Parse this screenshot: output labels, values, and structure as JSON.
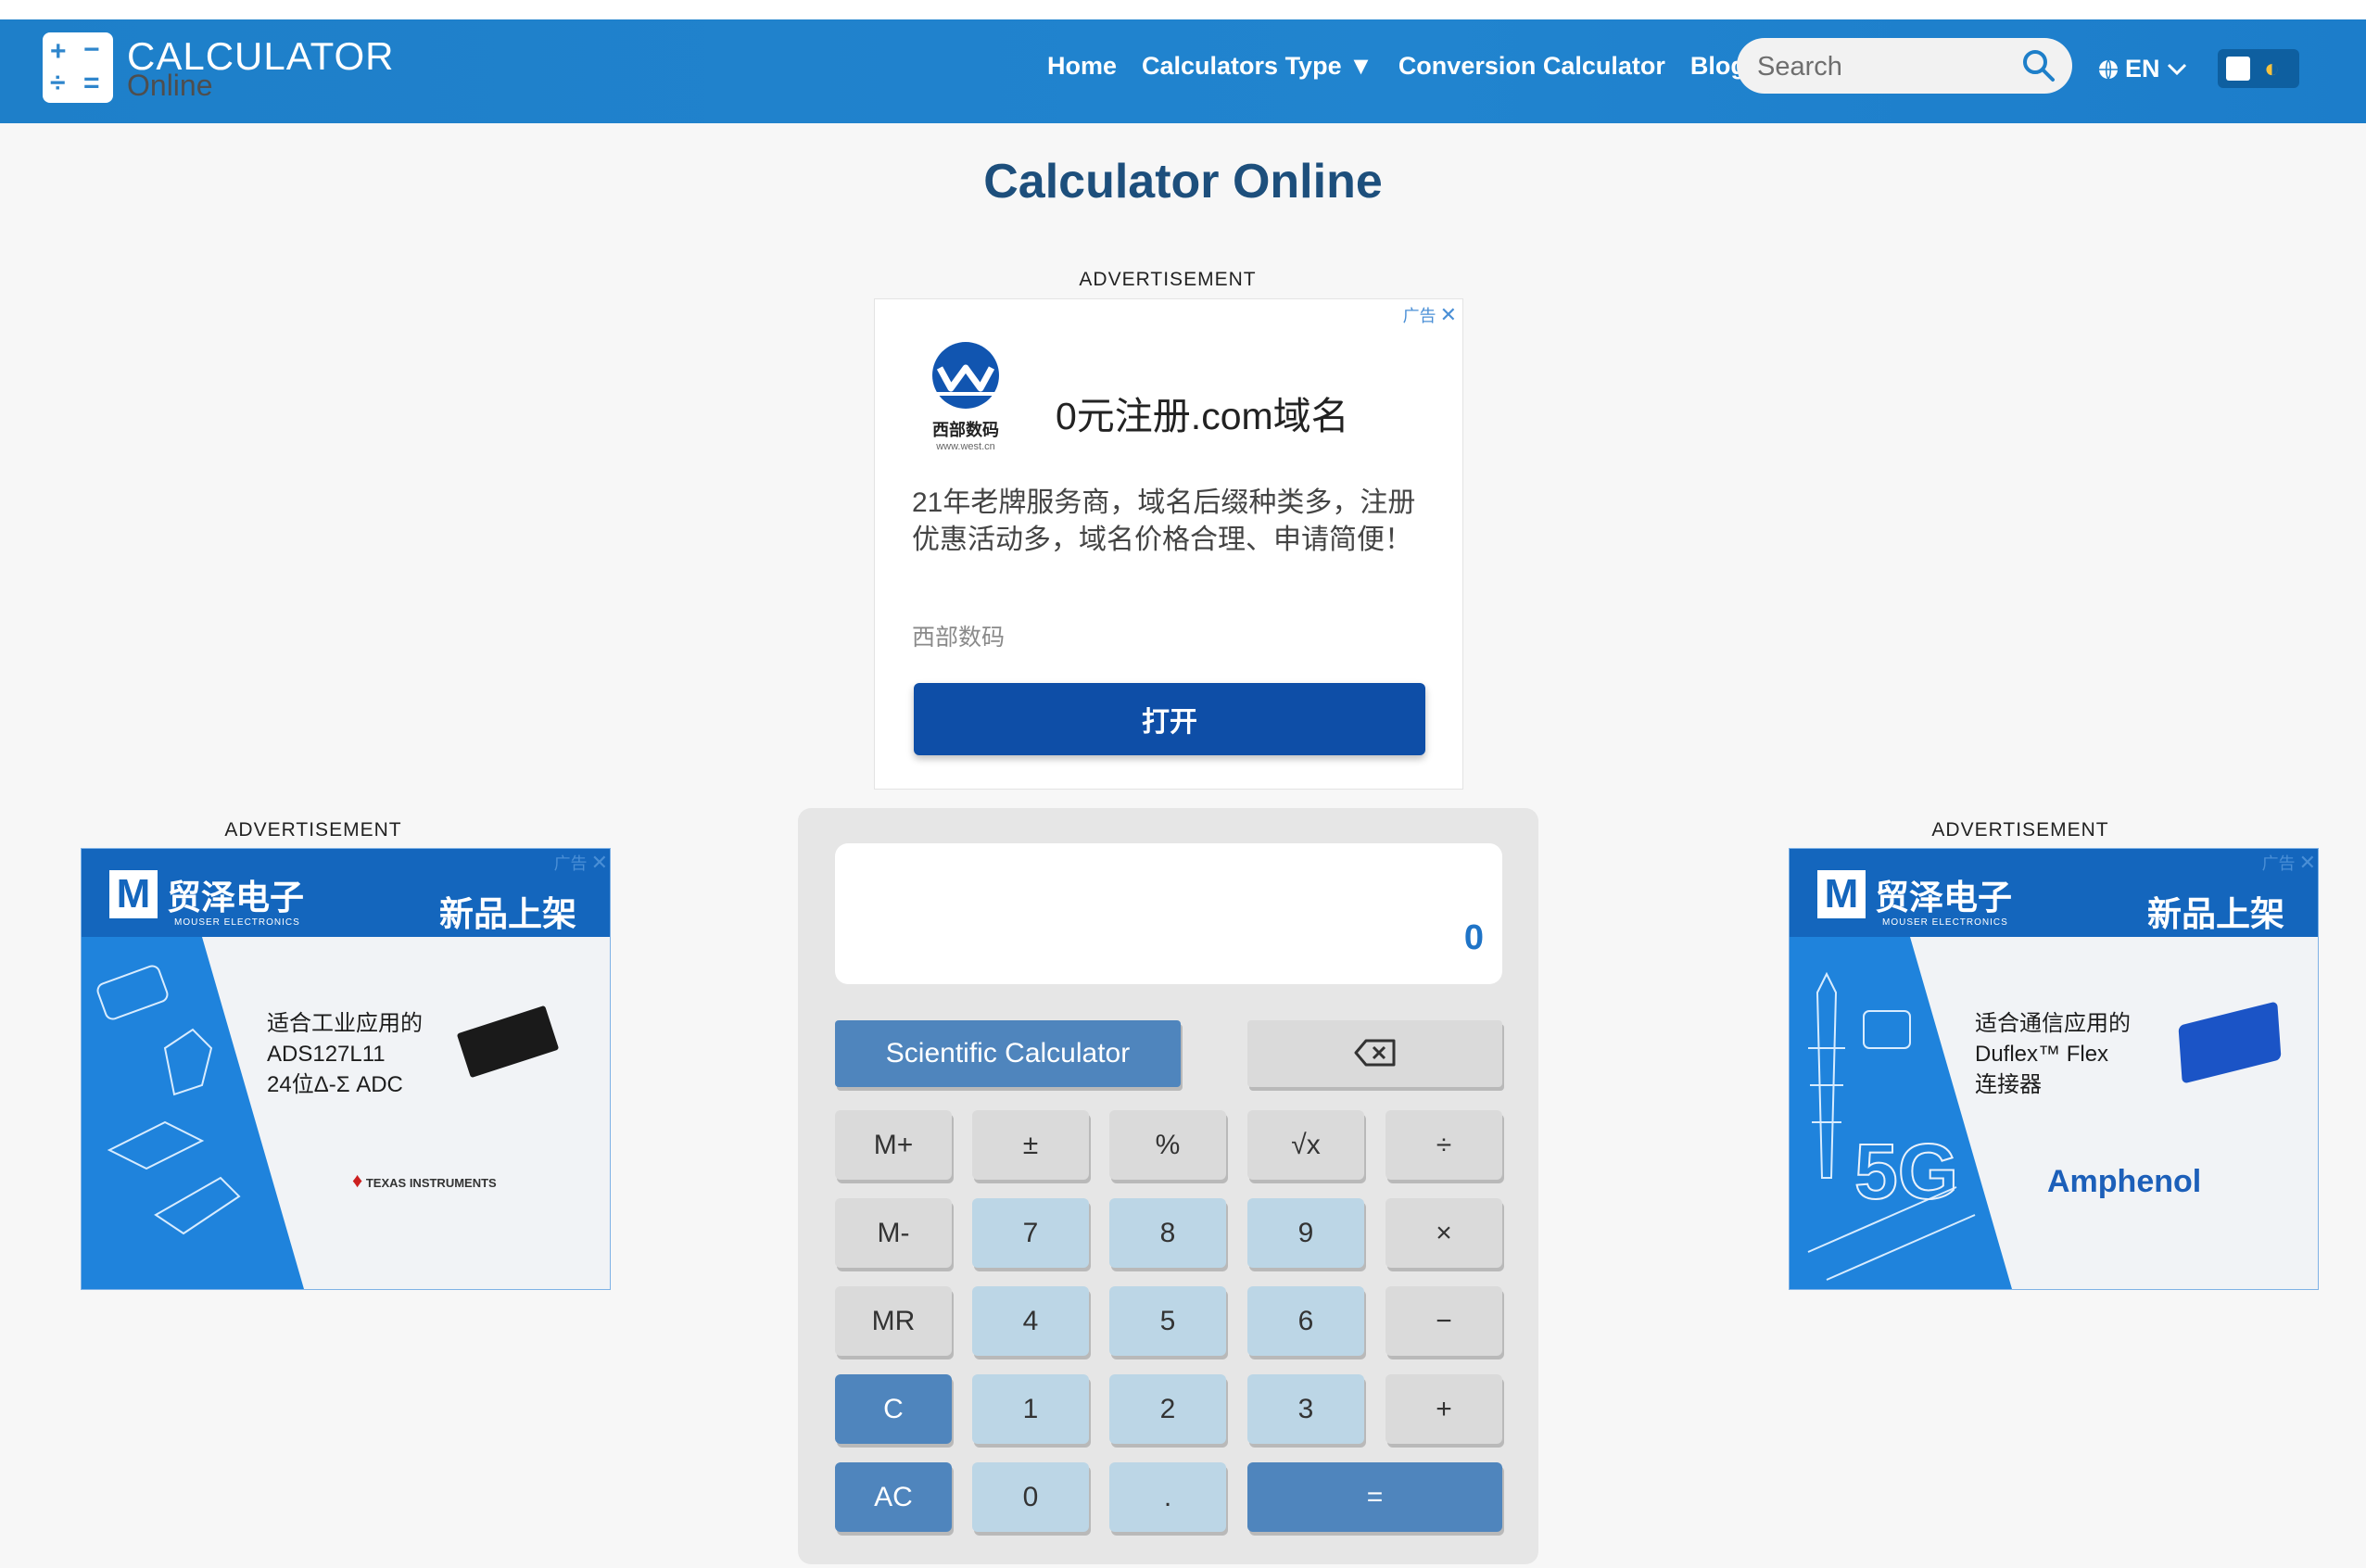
{
  "header": {
    "logo_title": "CALCULATOR",
    "logo_subtitle": "Online",
    "nav": {
      "home": "Home",
      "calculators_type": "Calculators Type ▼",
      "conversion": "Conversion Calculator",
      "blog": "Blog"
    },
    "search_placeholder": "Search",
    "language": "EN"
  },
  "page_title": "Calculator Online",
  "ad_label": "ADVERTISEMENT",
  "top_ad": {
    "adchoices": "广告",
    "logo_text": "西部数码",
    "logo_url": "www.west.cn",
    "headline": "0元注册.com域名",
    "description": "21年老牌服务商，域名后缀种类多，注册优惠活动多，域名价格合理、申请简便！",
    "brand": "西部数码",
    "button": "打开"
  },
  "left_ad": {
    "adchoices": "广告",
    "brand_cn": "贸泽电子",
    "brand_en": "MOUSER ELECTRONICS",
    "tagline": "新品上架",
    "line1": "适合工业应用的",
    "line2": "ADS127L11",
    "line3": "24位Δ-Σ ADC",
    "vendor": "TEXAS INSTRUMENTS"
  },
  "right_ad": {
    "adchoices": "广告",
    "brand_cn": "贸泽电子",
    "brand_en": "MOUSER ELECTRONICS",
    "tagline": "新品上架",
    "line1": "适合通信应用的",
    "line2": "Duflex™ Flex",
    "line3": "连接器",
    "vendor": "Amphenol",
    "graphic_text": "5G"
  },
  "calculator": {
    "display_value": "0",
    "scientific_button": "Scientific Calculator",
    "keys": {
      "m_plus": "M+",
      "plus_minus": "±",
      "percent": "%",
      "sqrt": "√x",
      "divide": "÷",
      "m_minus": "M-",
      "k7": "7",
      "k8": "8",
      "k9": "9",
      "multiply": "×",
      "mr": "MR",
      "k4": "4",
      "k5": "5",
      "k6": "6",
      "minus": "−",
      "c": "C",
      "k1": "1",
      "k2": "2",
      "k3": "3",
      "plus": "+",
      "ac": "AC",
      "k0": "0",
      "dot": ".",
      "equals": "="
    }
  },
  "colors": {
    "header_blue": "#1e7fc9",
    "calc_blue": "#4f85bd",
    "key_light": "#bcd6e6",
    "key_gray": "#dadada",
    "title_color": "#1d4f7c"
  }
}
